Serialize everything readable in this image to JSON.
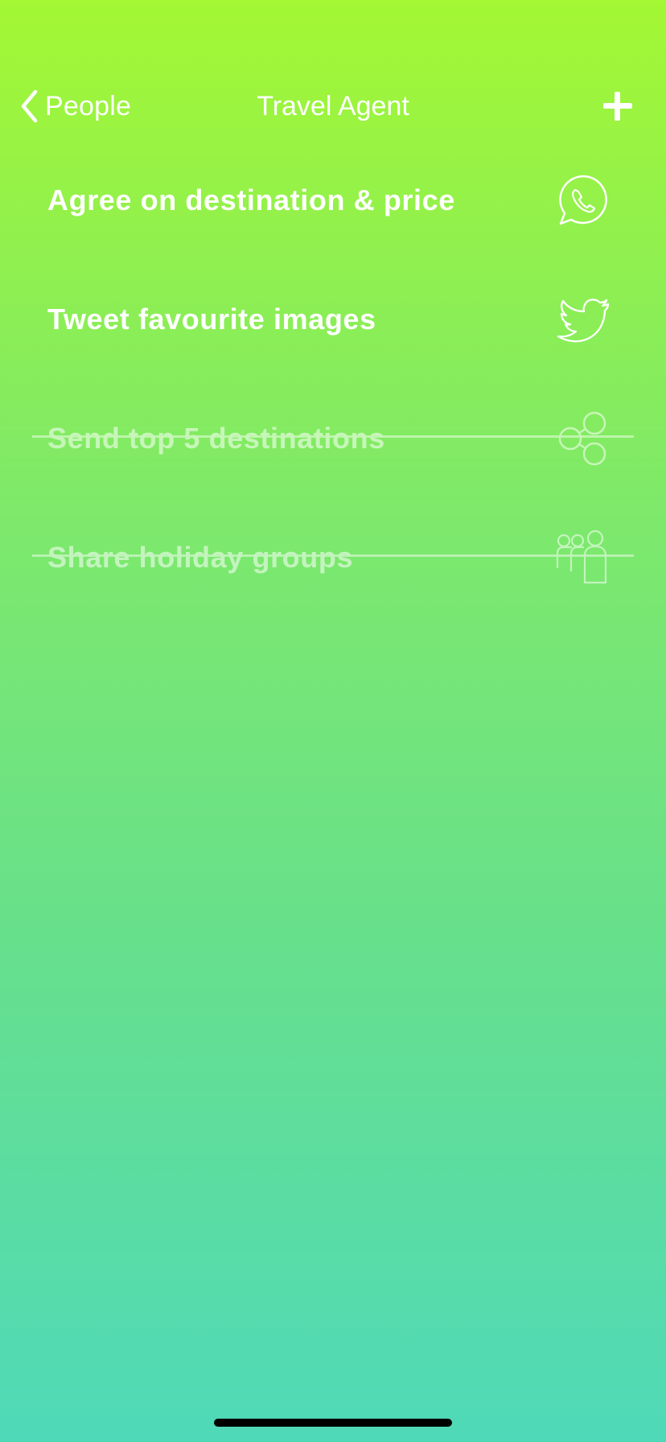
{
  "nav": {
    "back_label": "People",
    "title": "Travel Agent",
    "back_icon": "chevron-left-icon",
    "add_icon": "plus-icon"
  },
  "tasks": [
    {
      "label": "Agree on destination & price",
      "icon": "whatsapp-icon",
      "completed": false
    },
    {
      "label": "Tweet favourite images",
      "icon": "twitter-icon",
      "completed": false
    },
    {
      "label": "Send top 5 destinations",
      "icon": "share-icon",
      "completed": true
    },
    {
      "label": "Share holiday groups",
      "icon": "group-icon",
      "completed": true
    }
  ],
  "colors": {
    "gradient_top": "#a3f733",
    "gradient_bottom": "#4fd9b8",
    "text": "#ffffff"
  }
}
